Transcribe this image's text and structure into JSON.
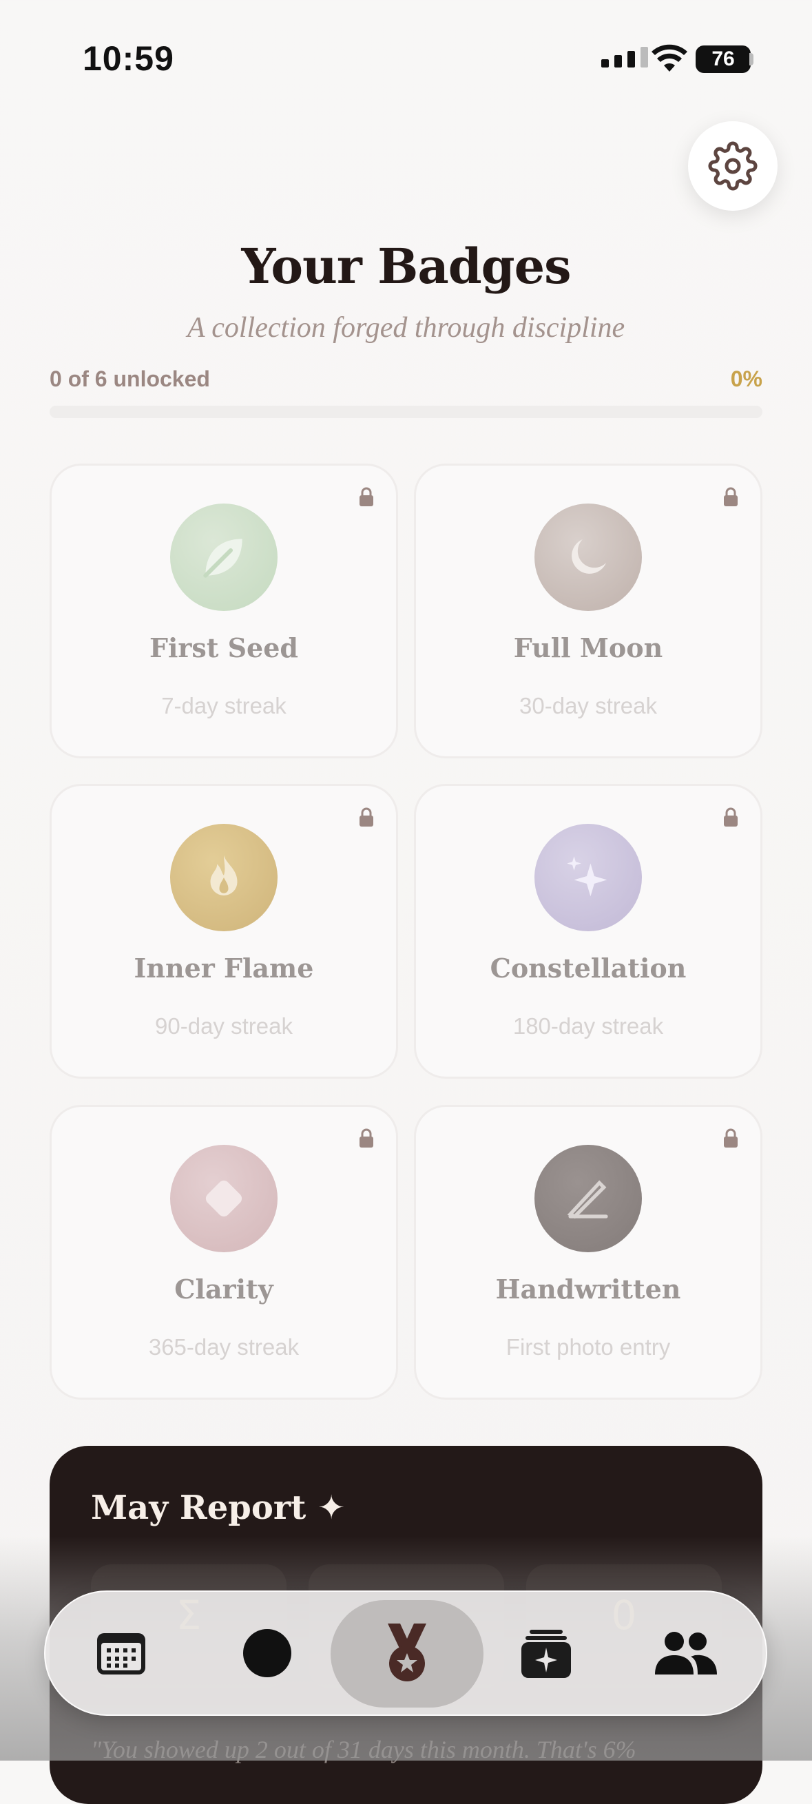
{
  "status_bar": {
    "time": "10:59",
    "battery": "76"
  },
  "header": {
    "title": "Your Badges",
    "subtitle": "A collection forged through discipline"
  },
  "progress": {
    "label": "0 of 6 unlocked",
    "percent_label": "0%",
    "fraction": 0.0
  },
  "badges": [
    {
      "name": "First Seed",
      "desc": "7-day streak",
      "icon": "leaf-icon",
      "color": "#cfe0cb",
      "locked": true
    },
    {
      "name": "Full Moon",
      "desc": "30-day streak",
      "icon": "moon-icon",
      "color": "#cbbfba",
      "locked": true
    },
    {
      "name": "Inner Flame",
      "desc": "90-day streak",
      "icon": "flame-icon",
      "color": "#d9c28f",
      "locked": true
    },
    {
      "name": "Constellation",
      "desc": "180-day streak",
      "icon": "sparkle-icon",
      "color": "#cbc4dc",
      "locked": true
    },
    {
      "name": "Clarity",
      "desc": "365-day streak",
      "icon": "diamond-icon",
      "color": "#dcc3c5",
      "locked": true
    },
    {
      "name": "Handwritten",
      "desc": "First photo entry",
      "icon": "pen-icon",
      "color": "#8f8785",
      "locked": true
    }
  ],
  "report": {
    "title": "May Report",
    "title_icon": "✦",
    "tiles": [
      {
        "icon": "Σ"
      },
      {
        "icon": ""
      },
      {
        "icon": "0"
      }
    ],
    "quote": "\"You showed up 2 out of 31 days this month. That's 6%"
  },
  "tabbar": {
    "tabs": [
      {
        "name": "calendar",
        "icon": "calendar-icon",
        "active": false
      },
      {
        "name": "record",
        "icon": "circle-icon",
        "active": false
      },
      {
        "name": "badges",
        "icon": "medal-icon",
        "active": true
      },
      {
        "name": "entries",
        "icon": "cards-sparkle-icon",
        "active": false
      },
      {
        "name": "community",
        "icon": "people-icon",
        "active": false
      }
    ]
  }
}
